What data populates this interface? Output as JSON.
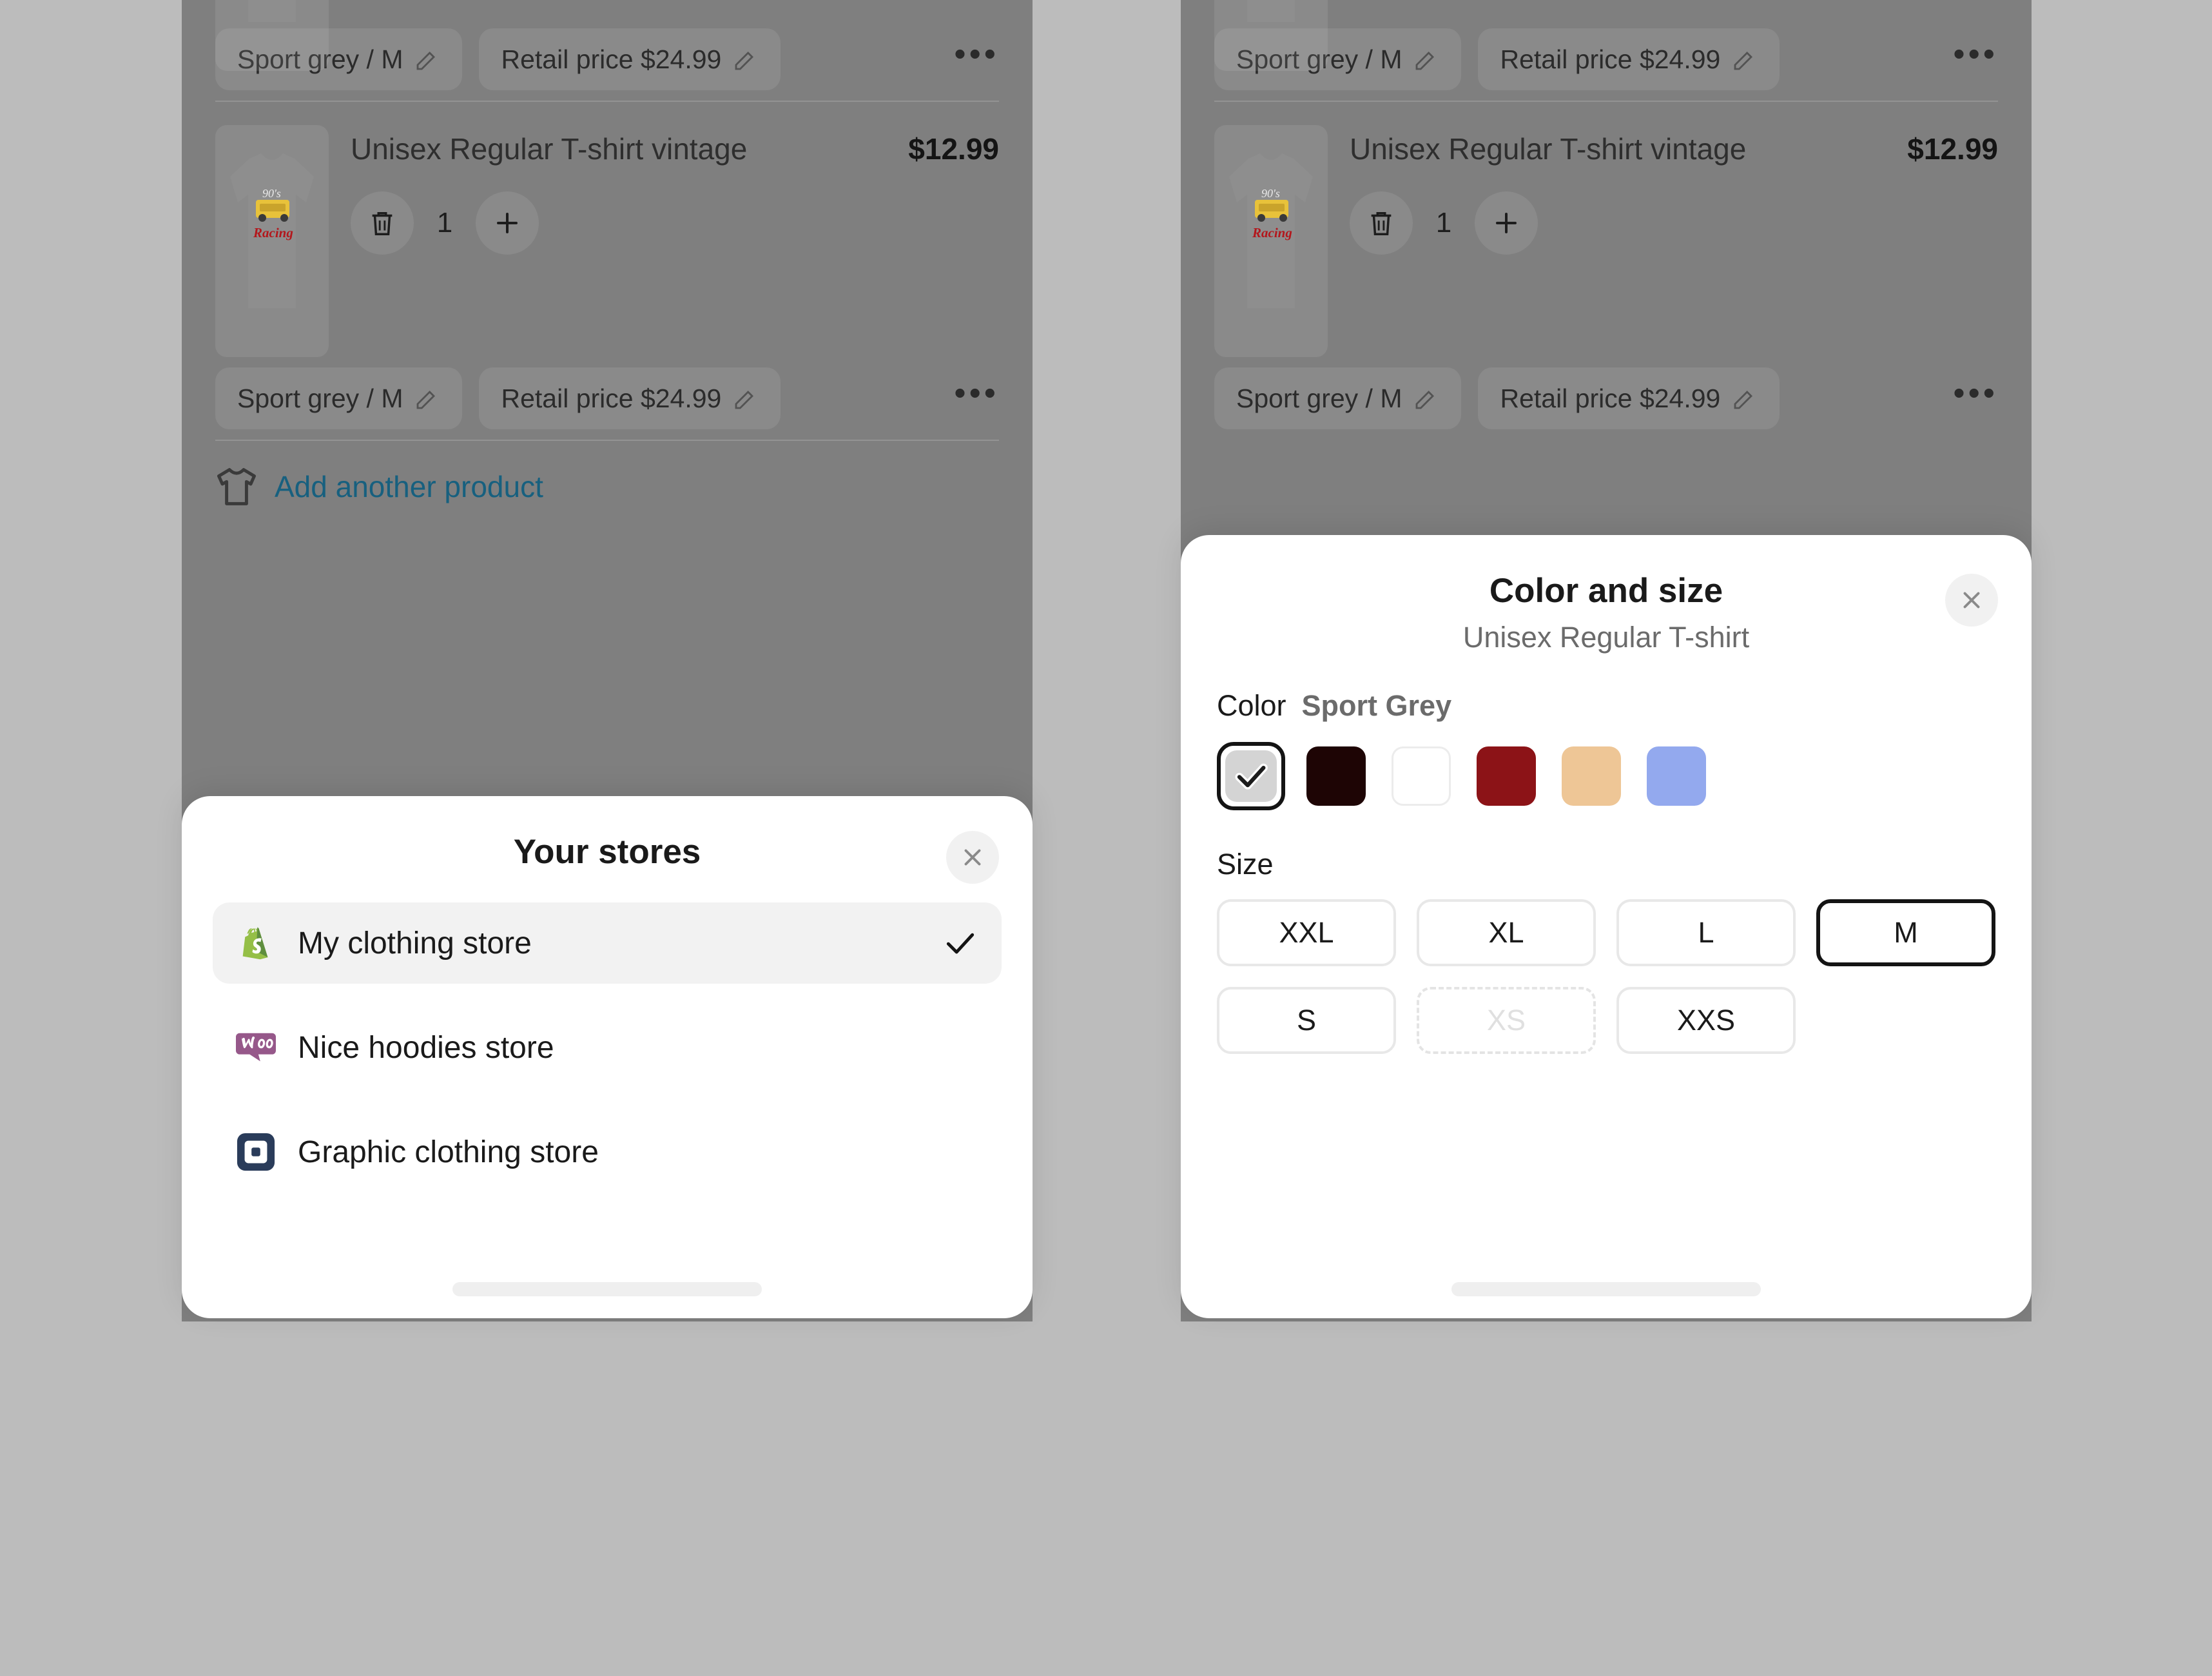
{
  "background_color": "#bcbcbc",
  "panel_dim_color": "#7f7f7f",
  "product_rows": [
    {
      "variant_chip": "Sport grey / M",
      "price_chip": "Retail price $24.99",
      "more_icon": "ellipsis-icon",
      "partial": true
    },
    {
      "title": "Unisex Regular T-shirt vintage",
      "price": "$12.99",
      "quantity": "1",
      "delete_icon": "trash-icon",
      "increment_icon": "plus-icon",
      "variant_chip": "Sport grey / M",
      "price_chip": "Retail price $24.99",
      "more_icon": "ellipsis-icon",
      "image_alt": "90's Racing grey t-shirt"
    }
  ],
  "add_product": {
    "label": "Add another product",
    "icon": "tshirt-icon",
    "color": "#17607f"
  },
  "stores_sheet": {
    "title": "Your stores",
    "close_icon": "close-icon",
    "items": [
      {
        "name": "My clothing store",
        "icon": "shopify-icon",
        "selected": true,
        "check_icon": "check-icon"
      },
      {
        "name": "Nice hoodies store",
        "icon": "woocommerce-icon",
        "selected": false
      },
      {
        "name": "Graphic clothing store",
        "icon": "square-icon",
        "selected": false
      }
    ]
  },
  "colorsize_sheet": {
    "title": "Color and size",
    "subtitle": "Unisex Regular T-shirt",
    "close_icon": "close-icon",
    "color_label": "Color",
    "color_value": "Sport Grey",
    "colors": [
      {
        "name": "Sport Grey",
        "hex": "#d4d4d4",
        "selected": true,
        "check_icon": "check-icon"
      },
      {
        "name": "Black",
        "hex": "#1e0505",
        "selected": false
      },
      {
        "name": "White",
        "hex": "#ffffff",
        "selected": false,
        "bordered": true
      },
      {
        "name": "Red",
        "hex": "#8c1317",
        "selected": false
      },
      {
        "name": "Tan",
        "hex": "#eec696",
        "selected": false
      },
      {
        "name": "Periwinkle",
        "hex": "#93a9ee",
        "selected": false
      }
    ],
    "size_label": "Size",
    "sizes": [
      {
        "label": "XXL",
        "selected": false,
        "disabled": false
      },
      {
        "label": "XL",
        "selected": false,
        "disabled": false
      },
      {
        "label": "L",
        "selected": false,
        "disabled": false
      },
      {
        "label": "M",
        "selected": true,
        "disabled": false
      },
      {
        "label": "S",
        "selected": false,
        "disabled": false
      },
      {
        "label": "XS",
        "selected": false,
        "disabled": true
      },
      {
        "label": "XXS",
        "selected": false,
        "disabled": false
      }
    ]
  }
}
